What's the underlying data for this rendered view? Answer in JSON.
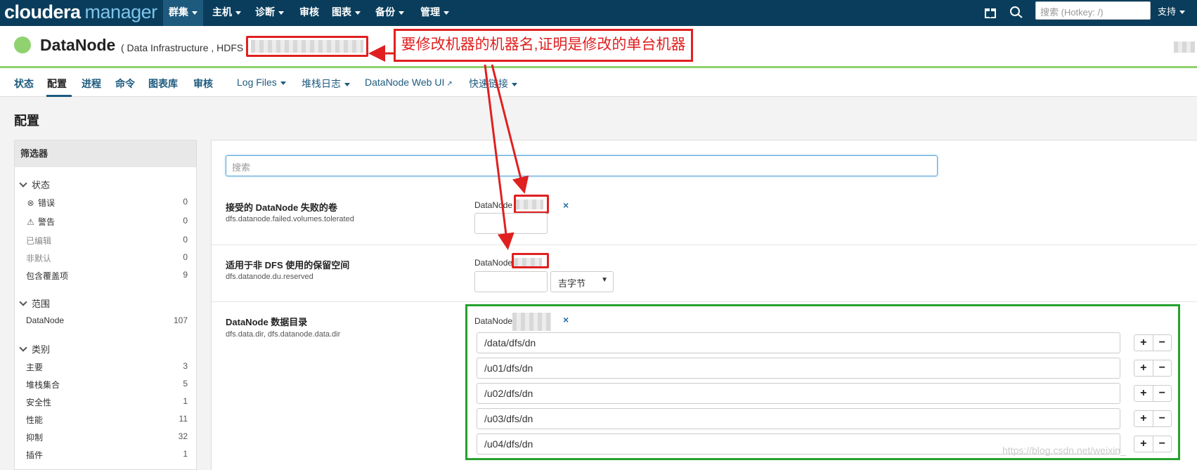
{
  "topbar": {
    "logo_main": "cloudera",
    "logo_sub": "manager",
    "nav": [
      {
        "label": "群集",
        "active": true
      },
      {
        "label": "主机",
        "active": false
      },
      {
        "label": "诊断",
        "active": false
      },
      {
        "label": "审核",
        "active": false
      },
      {
        "label": "图表",
        "active": false
      },
      {
        "label": "备份",
        "active": false
      },
      {
        "label": "管理",
        "active": false
      }
    ],
    "search_placeholder": "搜索 (Hotkey: /)",
    "support_label": "支持",
    "icons": [
      "gift-icon",
      "support-icon"
    ]
  },
  "header": {
    "title": "DataNode",
    "subtitle": "( Data Infrastructure , HDFS",
    "status_color": "#8fd26f"
  },
  "annotation": {
    "callout_text": "要修改机器的机器名,证明是修改的单台机器",
    "color": "#e02020"
  },
  "tabs": {
    "items": [
      {
        "label": "状态"
      },
      {
        "label": "配置",
        "active": true
      },
      {
        "label": "进程"
      },
      {
        "label": "命令"
      },
      {
        "label": "图表库"
      },
      {
        "label": "审核"
      }
    ],
    "dropdowns": [
      {
        "label": "Log Files"
      },
      {
        "label": "堆栈日志"
      },
      {
        "label": "DataNode Web UI"
      },
      {
        "label": "快速链接"
      }
    ]
  },
  "page_title": "配置",
  "sidebar": {
    "heading": "筛选器",
    "groups": {
      "status": {
        "label": "状态",
        "items": [
          {
            "label": "错误",
            "count": "0",
            "icon": "error-icon"
          },
          {
            "label": "警告",
            "count": "0",
            "icon": "warning-icon"
          },
          {
            "label": "已编辑",
            "count": "0"
          },
          {
            "label": "非默认",
            "count": "0"
          },
          {
            "label": "包含覆盖项",
            "count": "9"
          }
        ]
      },
      "scope": {
        "label": "范围",
        "items": [
          {
            "label": "DataNode",
            "count": "107"
          }
        ]
      },
      "category": {
        "label": "类别",
        "items": [
          {
            "label": "主要",
            "count": "3"
          },
          {
            "label": "堆栈集合",
            "count": "5"
          },
          {
            "label": "安全性",
            "count": "1"
          },
          {
            "label": "性能",
            "count": "11"
          },
          {
            "label": "抑制",
            "count": "32"
          },
          {
            "label": "插件",
            "count": "1"
          }
        ]
      }
    }
  },
  "main": {
    "search_placeholder": "搜索",
    "properties": [
      {
        "title": "接受的 DataNode 失败的卷",
        "key": "dfs.datanode.failed.volumes.tolerated",
        "scope": "DataNode",
        "value": ""
      },
      {
        "title": "适用于非 DFS 使用的保留空间",
        "key": "dfs.datanode.du.reserved",
        "scope": "DataNode",
        "value": "",
        "unit": "吉字节"
      },
      {
        "title": "DataNode 数据目录",
        "key": "dfs.data.dir, dfs.datanode.data.dir",
        "scope": "DataNode",
        "values": [
          "/data/dfs/dn",
          "/u01/dfs/dn",
          "/u02/dfs/dn",
          "/u03/dfs/dn",
          "/u04/dfs/dn"
        ]
      }
    ],
    "close_glyph": "×",
    "plus_glyph": "+",
    "minus_glyph": "−"
  },
  "watermark": "https://blog.csdn.net/weixin_"
}
